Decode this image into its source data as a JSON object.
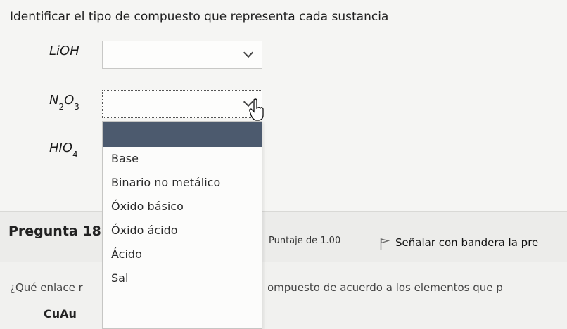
{
  "question": {
    "prompt": "Identificar el tipo de compuesto que representa cada sustancia",
    "items": [
      {
        "formula_base": "LiOH",
        "selected": ""
      },
      {
        "formula_parts": [
          "N",
          "2",
          "O",
          "3"
        ],
        "selected": ""
      },
      {
        "formula_parts": [
          "HIO",
          "4"
        ],
        "selected": ""
      }
    ]
  },
  "dropdown": {
    "options": [
      "Base",
      "Binario no metálico",
      "Óxido básico",
      "Óxido ácido",
      "Ácido",
      "Sal"
    ],
    "highlight_color": "#4c5a6e"
  },
  "next_question": {
    "number_label": "Pregunta 18",
    "points_label": "Puntaje de 1.00",
    "flag_label": "Señalar con bandera la pre",
    "text_left": "¿Qué enlace r",
    "text_right": "ompuesto de acuerdo a los elementos que p",
    "compound": "CuAu"
  },
  "icons": {
    "chevron": "chevron-down-icon",
    "flag": "flag-icon",
    "cursor": "hand-pointer-icon"
  }
}
